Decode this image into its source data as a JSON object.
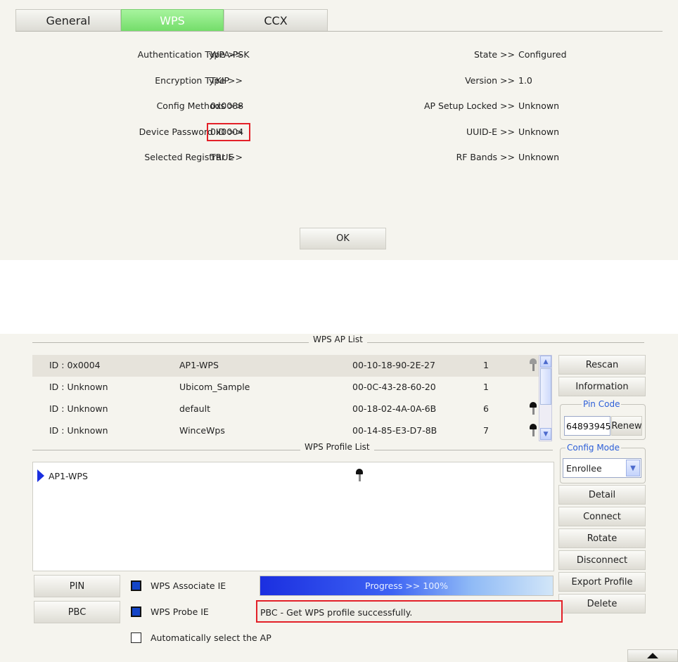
{
  "top_dialog": {
    "tabs": [
      {
        "label": "General"
      },
      {
        "label": "WPS"
      },
      {
        "label": "CCX"
      }
    ],
    "separator": ">>",
    "left_fields": [
      {
        "label": "Authentication Type",
        "value": "WPA-PSK"
      },
      {
        "label": "Encryption Type",
        "value": "TKIP"
      },
      {
        "label": "Config Methods",
        "value": "0x0088"
      },
      {
        "label": "Device Password ID",
        "value": "0x0004"
      },
      {
        "label": "Selected Registrar",
        "value": "TRUE"
      }
    ],
    "right_fields": [
      {
        "label": "State",
        "value": "Configured"
      },
      {
        "label": "Version",
        "value": "1.0"
      },
      {
        "label": "AP Setup Locked",
        "value": "Unknown"
      },
      {
        "label": "UUID-E",
        "value": "Unknown"
      },
      {
        "label": "RF Bands",
        "value": "Unknown"
      }
    ],
    "ok_label": "OK"
  },
  "wps_panel": {
    "ap_list_title": "WPS AP List",
    "ap_list": [
      {
        "id": "ID : 0x0004",
        "ssid": "AP1-WPS",
        "bssid": "00-10-18-90-2E-27",
        "channel": "1",
        "icon": "lock-icon"
      },
      {
        "id": "ID : Unknown",
        "ssid": "Ubicom_Sample",
        "bssid": "00-0C-43-28-60-20",
        "channel": "1",
        "icon": ""
      },
      {
        "id": "ID : Unknown",
        "ssid": "default",
        "bssid": "00-18-02-4A-0A-6B",
        "channel": "6",
        "icon": "lock-icon"
      },
      {
        "id": "ID : Unknown",
        "ssid": "WinceWps",
        "bssid": "00-14-85-E3-D7-8B",
        "channel": "7",
        "icon": "lock-icon"
      }
    ],
    "profile_list_title": "WPS Profile List",
    "profiles": [
      {
        "name": "AP1-WPS",
        "icon": "lock-icon"
      }
    ],
    "buttons": {
      "rescan": "Rescan",
      "information": "Information",
      "renew": "Renew",
      "detail": "Detail",
      "connect": "Connect",
      "rotate": "Rotate",
      "disconnect": "Disconnect",
      "export_profile": "Export Profile",
      "delete": "Delete",
      "pin": "PIN",
      "pbc": "PBC"
    },
    "pin_code": {
      "title": "Pin Code",
      "value": "64893945"
    },
    "config_mode": {
      "title": "Config Mode",
      "selected": "Enrollee"
    },
    "checkboxes": [
      {
        "label": "WPS Associate IE",
        "checked": true
      },
      {
        "label": "WPS Probe IE",
        "checked": true
      },
      {
        "label": "Automatically select the AP",
        "checked": false
      }
    ],
    "progress": {
      "label": "Progress >> 100%",
      "value": 1.0
    },
    "status_text": "PBC - Get WPS profile successfully.",
    "colors": {
      "accent_tab": "#74dd6a",
      "highlight": "#e32028",
      "progress": "#1b2fe0"
    }
  }
}
